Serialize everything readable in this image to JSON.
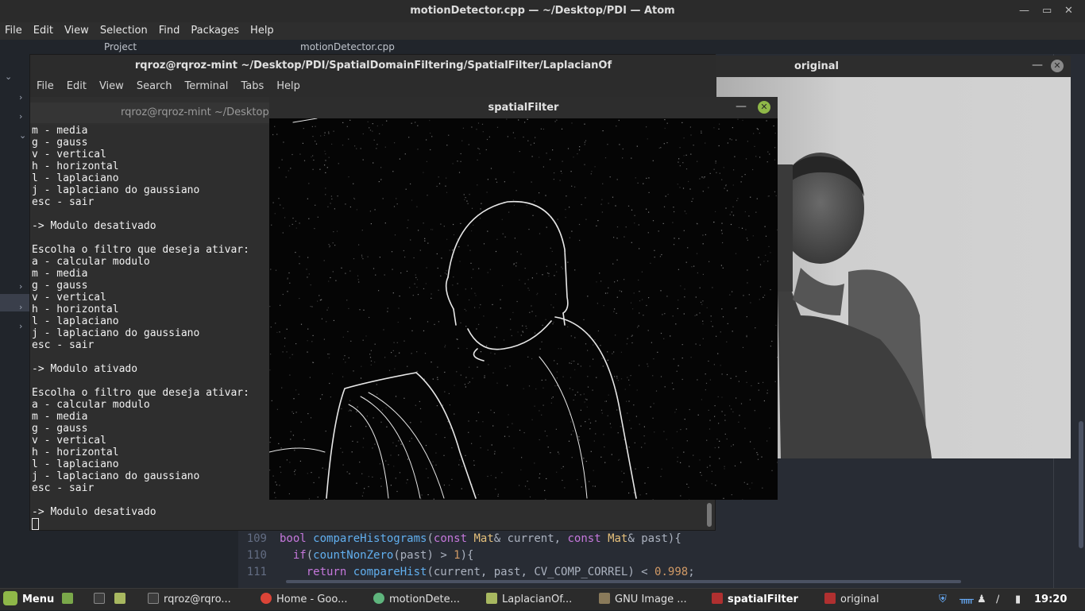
{
  "atom": {
    "title": "motionDetector.cpp — ~/Desktop/PDI — Atom",
    "menu": [
      "File",
      "Edit",
      "View",
      "Selection",
      "Find",
      "Packages",
      "Help"
    ],
    "tabs": {
      "project": "Project",
      "file": "motionDetector.cpp"
    },
    "code": [
      {
        "ln": "109",
        "parts": [
          [
            "kw",
            "bool "
          ],
          [
            "fn",
            "compareHistograms"
          ],
          [
            "pl",
            "("
          ],
          [
            "kw",
            "const "
          ],
          [
            "ty",
            "Mat"
          ],
          [
            "pl",
            "& current, "
          ],
          [
            "kw",
            "const "
          ],
          [
            "ty",
            "Mat"
          ],
          [
            "pl",
            "& past){"
          ]
        ]
      },
      {
        "ln": "110",
        "parts": [
          [
            "pl",
            "  "
          ],
          [
            "kw",
            "if"
          ],
          [
            "pl",
            "("
          ],
          [
            "fn",
            "countNonZero"
          ],
          [
            "pl",
            "(past) > "
          ],
          [
            "num",
            "1"
          ],
          [
            "pl",
            "){"
          ]
        ]
      },
      {
        "ln": "111",
        "parts": [
          [
            "pl",
            "    "
          ],
          [
            "kw",
            "return "
          ],
          [
            "fn",
            "compareHist"
          ],
          [
            "pl",
            "(current, past, CV_COMP_CORREL) < "
          ],
          [
            "num",
            "0.998"
          ],
          [
            "pl",
            ";"
          ]
        ]
      }
    ]
  },
  "terminal": {
    "title": "rqroz@rqroz-mint ~/Desktop/PDI/SpatialDomainFiltering/SpatialFilter/LaplacianOf",
    "menu": [
      "File",
      "Edit",
      "View",
      "Search",
      "Terminal",
      "Tabs",
      "Help"
    ],
    "tab_title": "rqroz@rqroz-mint ~/Desktop/PDI",
    "lines": [
      "m - media",
      "g - gauss",
      "v - vertical",
      "h - horizontal",
      "l - laplaciano",
      "j - laplaciano do gaussiano",
      "esc - sair",
      "",
      "-> Modulo desativado",
      "",
      "Escolha o filtro que deseja ativar:",
      "a - calcular modulo",
      "m - media",
      "g - gauss",
      "v - vertical",
      "h - horizontal",
      "l - laplaciano",
      "j - laplaciano do gaussiano",
      "esc - sair",
      "",
      "-> Modulo ativado",
      "",
      "Escolha o filtro que deseja ativar:",
      "a - calcular modulo",
      "m - media",
      "g - gauss",
      "v - vertical",
      "h - horizontal",
      "l - laplaciano",
      "j - laplaciano do gaussiano",
      "esc - sair",
      "",
      "-> Modulo desativado"
    ]
  },
  "windows": {
    "original": {
      "title": "original"
    },
    "spatial": {
      "title": "spatialFilter"
    }
  },
  "taskbar": {
    "menu_label": "Menu",
    "items": [
      {
        "label": "rqroz@rqro...",
        "icon": "terminal-icon",
        "color": "#3c3c3c",
        "active": false
      },
      {
        "label": "Home - Goo...",
        "icon": "chrome-icon",
        "color": "#db4437",
        "active": false
      },
      {
        "label": "motionDete...",
        "icon": "atom-icon",
        "color": "#5fb57d",
        "active": false
      },
      {
        "label": "LaplacianOf...",
        "icon": "folder-icon",
        "color": "#a8b860",
        "active": false
      },
      {
        "label": "GNU Image ...",
        "icon": "gimp-icon",
        "color": "#8a7a5a",
        "active": false
      },
      {
        "label": "spatialFilter",
        "icon": "opencv-window-icon",
        "color": "#b03030",
        "active": true
      },
      {
        "label": "original",
        "icon": "opencv-window-icon",
        "color": "#b03030",
        "active": false
      }
    ],
    "clock": "19:20"
  }
}
